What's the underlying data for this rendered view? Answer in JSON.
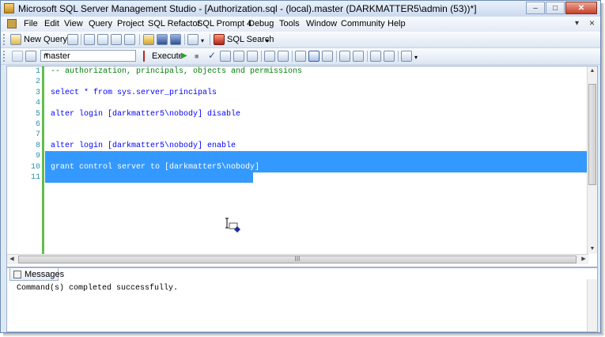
{
  "window": {
    "title": "Microsoft SQL Server Management Studio - [Authorization.sql - (local).master (DARKMATTER5\\admin (53))*]",
    "minimize": "–",
    "maximize": "□",
    "close": "✕"
  },
  "menu": {
    "items": [
      "File",
      "Edit",
      "View",
      "Query",
      "Project",
      "SQL Refactor",
      "SQL Prompt 4",
      "Debug",
      "Tools",
      "Window",
      "Community",
      "Help"
    ],
    "doc_controls": {
      "pin": "▾",
      "close": "×"
    }
  },
  "toolbar1": {
    "new_query": "New Query",
    "sql_search": "SQL Search"
  },
  "toolbar2": {
    "database": "master",
    "execute": "Execute"
  },
  "editor": {
    "lines": [
      {
        "num": "1",
        "text": "-- authorization, principals, objects and permissions",
        "kind": "comment"
      },
      {
        "num": "2",
        "text": "",
        "kind": "plain"
      },
      {
        "num": "3",
        "text": "select * from sys.server_principals",
        "kind": "plain"
      },
      {
        "num": "4",
        "text": "",
        "kind": "plain"
      },
      {
        "num": "5",
        "text": "alter login [darkmatter5\\nobody] disable",
        "kind": "plain"
      },
      {
        "num": "6",
        "text": "",
        "kind": "plain"
      },
      {
        "num": "7",
        "text": "",
        "kind": "plain"
      },
      {
        "num": "8",
        "text": "alter login [darkmatter5\\nobody] enable",
        "kind": "plain"
      },
      {
        "num": "9",
        "text": "",
        "kind": "selected"
      },
      {
        "num": "10",
        "text": "grant control server to [darkmatter5\\nobody]",
        "kind": "selected"
      },
      {
        "num": "11",
        "text": "",
        "kind": "selected-partial"
      }
    ],
    "hscroll_grip": "III"
  },
  "results": {
    "tab_label": "Messages",
    "message": "Command(s) completed successfully."
  },
  "colors": {
    "selection": "#3399ff",
    "comment": "#008000",
    "keyword": "#0000ff",
    "line_number": "#2b91af",
    "change_bar": "#5fbf4d"
  }
}
